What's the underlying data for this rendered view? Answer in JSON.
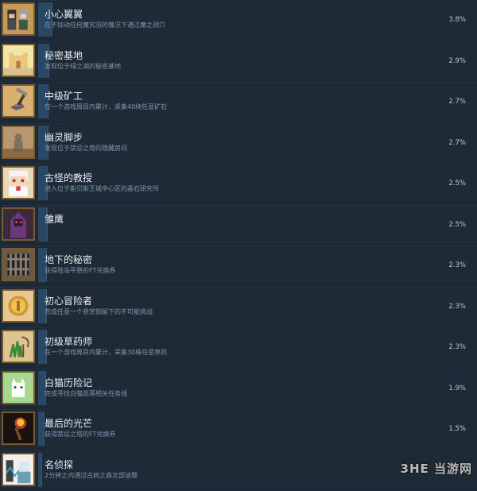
{
  "achievements": [
    {
      "title": "小心翼翼",
      "desc": "在不惊动任何魔究羽的情况下通过魔之洞穴",
      "pct": "3.8%",
      "pct_value": 3.8,
      "icon": "hooded-characters-icon"
    },
    {
      "title": "秘密基地",
      "desc": "发现位于绿之湖的秘密基地",
      "pct": "2.9%",
      "pct_value": 2.9,
      "icon": "sandcastle-icon"
    },
    {
      "title": "中级矿工",
      "desc": "在一个游戏周目内累计，采集40块任意矿石",
      "pct": "2.7%",
      "pct_value": 2.7,
      "icon": "pickaxe-ore-icon"
    },
    {
      "title": "幽灵脚步",
      "desc": "发现位于禁忌之塔的隐藏房间",
      "pct": "2.7%",
      "pct_value": 2.7,
      "icon": "ghost-silhouette-icon"
    },
    {
      "title": "古怪的教授",
      "desc": "进入位于斯贝斯王城中心区的晶石研究所",
      "pct": "2.5%",
      "pct_value": 2.5,
      "icon": "white-haired-professor-icon"
    },
    {
      "title": "雏鹰",
      "desc": "",
      "pct": "2.5%",
      "pct_value": 2.5,
      "icon": "purple-hooded-figure-icon"
    },
    {
      "title": "地下的秘密",
      "desc": "获得瑶岛平原的FT兑换券",
      "pct": "2.3%",
      "pct_value": 2.3,
      "icon": "iron-gate-icon"
    },
    {
      "title": "初心冒险者",
      "desc": "完成任意一个悬赏钢留下的不可能挑战",
      "pct": "2.3%",
      "pct_value": 2.3,
      "icon": "gold-coin-icon"
    },
    {
      "title": "初级草药师",
      "desc": "在一个游戏周目内累计，采集30株任意草药",
      "pct": "2.3%",
      "pct_value": 2.3,
      "icon": "herb-sickle-icon"
    },
    {
      "title": "白猫历险记",
      "desc": "完成寻找白猫凯蒂相关任务线",
      "pct": "1.9%",
      "pct_value": 1.9,
      "icon": "white-cat-icon"
    },
    {
      "title": "最后的光芒",
      "desc": "获得禁忌之塔的FT兑换券",
      "pct": "1.5%",
      "pct_value": 1.5,
      "icon": "torch-icon"
    },
    {
      "title": "名侦探",
      "desc": "2分钟之内通过古树之森北部谜题",
      "pct": "",
      "pct_value": null,
      "icon": "detective-icon"
    }
  ],
  "watermark": "3HE 当游网"
}
